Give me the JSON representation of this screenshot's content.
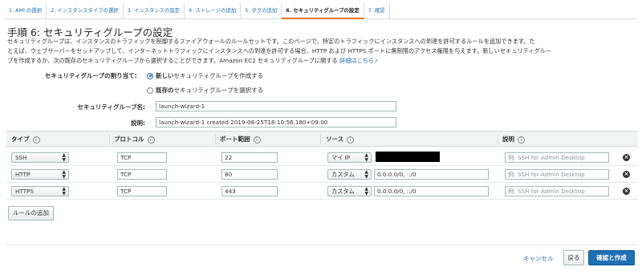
{
  "steps": [
    {
      "label": "1. AMI の選択"
    },
    {
      "label": "2. インスタンスタイプの選択"
    },
    {
      "label": "3. インスタンスの設定"
    },
    {
      "label": "4. ストレージの追加"
    },
    {
      "label": "5. タグの追加"
    },
    {
      "label": "6. セキュリティグループの設定"
    },
    {
      "label": "7. 確認"
    }
  ],
  "active_step_index": 5,
  "page": {
    "title": "手順 6: セキュリティグループの設定",
    "description_line1": "セキュリティグループは、インスタンスのトラフィックを制御するファイアウォールのルールセットです。このページで、特定のトラフィックにインスタンスへの到達を許可するルールを追加できます。た",
    "description_line2": "とえば、ウェブサーバーをセットアップして、インターネットトラフィックにインスタンスへの到達を許可する場合、HTTP および HTTPS ポートに無制限のアクセス権限を与えます。新しいセキュリティグルー",
    "description_line3": "プを作成するか、次の既存のセキュリティグループから選択することができます。Amazon EC2 セキュリティグループに関する",
    "more_link": "詳細はこちら",
    "more_link_icon": "external-link-icon"
  },
  "assignment": {
    "label": "セキュリティグループの割り当て:",
    "option_new_bold": "新しい",
    "option_new_rest": "セキュリティグループを作成する",
    "option_existing_bold": "既存の",
    "option_existing_rest": "セキュリティグループを選択する",
    "selected": "new"
  },
  "form": {
    "name_label": "セキュリティグループ名:",
    "name_value": "launch-wizard-1",
    "desc_label": "説明:",
    "desc_value": "launch-wizard-1 created 2019-08-25T18:10:56.180+09:00"
  },
  "table": {
    "headers": {
      "type": "タイプ",
      "protocol": "プロトコル",
      "port": "ポート範囲",
      "source": "ソース",
      "description": "説明"
    },
    "info_icon": "info-icon",
    "rows": [
      {
        "type": "SSH",
        "protocol": "TCP",
        "port": "22",
        "source_type": "マイ IP",
        "source_value": "",
        "source_redacted": true,
        "description_placeholder": "例: SSH for Admin Desktop"
      },
      {
        "type": "HTTP",
        "protocol": "TCP",
        "port": "80",
        "source_type": "カスタム",
        "source_value": "0.0.0.0/0, ::/0",
        "source_redacted": false,
        "description_placeholder": "例: SSH for Admin Desktop"
      },
      {
        "type": "HTTPS",
        "protocol": "TCP",
        "port": "443",
        "source_type": "カスタム",
        "source_value": "0.0.0.0/0, ::/0",
        "source_redacted": false,
        "description_placeholder": "例: SSH for Admin Desktop"
      }
    ],
    "delete_icon": "close-circle-icon",
    "select_icon": "select-arrows-icon"
  },
  "add_rule_label": "ルールの追加",
  "footer": {
    "cancel_label": "キャンセル",
    "back_label": "戻る",
    "review_label": "確認と作成"
  },
  "colors": {
    "link": "#1f6fb5",
    "primary": "#1f6fb5",
    "active_step_underline": "#ec7211",
    "header_bg": "#f2f3f3"
  }
}
